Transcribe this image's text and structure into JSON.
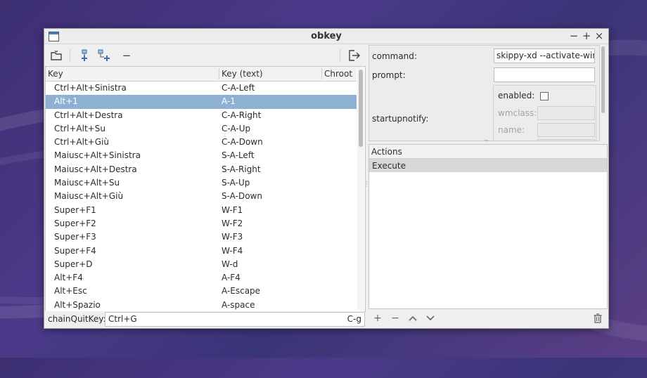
{
  "window": {
    "title": "obkey",
    "controls": {
      "minimize": "−",
      "maximize": "+",
      "close": "×"
    }
  },
  "toolbar": {
    "icons": [
      "open-folder-icon",
      "add-sibling-icon",
      "add-child-icon",
      "remove-icon",
      "quit-icon"
    ],
    "remove_glyph": "−"
  },
  "keylist": {
    "columns": [
      "Key",
      "Key (text)",
      "Chroot"
    ],
    "selected_index": 1,
    "rows": [
      {
        "key": "Ctrl+Alt+Sinistra",
        "text": "C-A-Left"
      },
      {
        "key": "Alt+1",
        "text": "A-1"
      },
      {
        "key": "Ctrl+Alt+Destra",
        "text": "C-A-Right"
      },
      {
        "key": "Ctrl+Alt+Su",
        "text": "C-A-Up"
      },
      {
        "key": "Ctrl+Alt+Giù",
        "text": "C-A-Down"
      },
      {
        "key": "Maiusc+Alt+Sinistra",
        "text": "S-A-Left"
      },
      {
        "key": "Maiusc+Alt+Destra",
        "text": "S-A-Right"
      },
      {
        "key": "Maiusc+Alt+Su",
        "text": "S-A-Up"
      },
      {
        "key": "Maiusc+Alt+Giù",
        "text": "S-A-Down"
      },
      {
        "key": "Super+F1",
        "text": "W-F1"
      },
      {
        "key": "Super+F2",
        "text": "W-F2"
      },
      {
        "key": "Super+F3",
        "text": "W-F3"
      },
      {
        "key": "Super+F4",
        "text": "W-F4"
      },
      {
        "key": "Super+D",
        "text": "W-d"
      },
      {
        "key": "Alt+F4",
        "text": "A-F4"
      },
      {
        "key": "Alt+Esc",
        "text": "A-Escape"
      },
      {
        "key": "Alt+Spazio",
        "text": "A-space"
      }
    ]
  },
  "chain": {
    "label": "chainQuitKey:",
    "value": "Ctrl+G",
    "text": "C-g"
  },
  "properties": {
    "command_label": "command:",
    "command_value": "skippy-xd --activate-wind",
    "prompt_label": "prompt:",
    "prompt_value": "",
    "startupnotify_label": "startupnotify:",
    "enabled_label": "enabled:",
    "wmclass_label": "wmclass:",
    "name_label": "name:"
  },
  "actions": {
    "header": "Actions",
    "items": [
      "Execute"
    ],
    "buttons": {
      "add": "+",
      "remove": "−"
    }
  }
}
